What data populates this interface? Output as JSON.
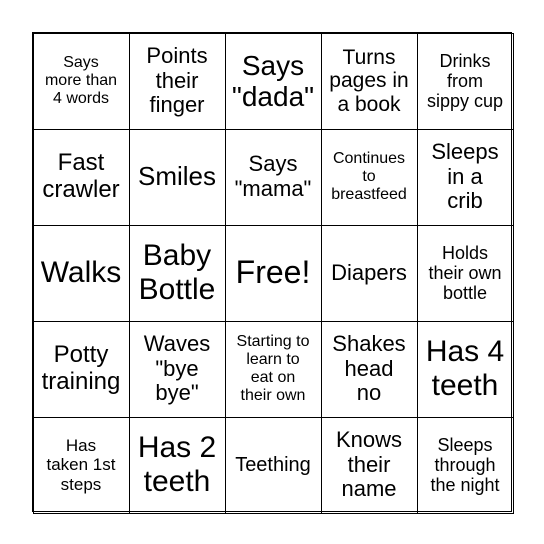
{
  "card": {
    "cells": [
      "Says\nmore than\n4 words",
      "Points\ntheir\nfinger",
      "Says\n\"dada\"",
      "Turns\npages in\na book",
      "Drinks\nfrom\nsippy cup",
      "Fast\ncrawler",
      "Smiles",
      "Says\n\"mama\"",
      "Continues\nto\nbreastfeed",
      "Sleeps\nin a\ncrib",
      "Walks",
      "Baby\nBottle",
      "Free!",
      "Diapers",
      "Holds\ntheir own\nbottle",
      "Potty\ntraining",
      "Waves\n\"bye\nbye\"",
      "Starting to\nlearn to\neat on\ntheir own",
      "Shakes\nhead\nno",
      "Has 4\nteeth",
      "Has\ntaken 1st\nsteps",
      "Has 2\nteeth",
      "Teething",
      "Knows\ntheir\nname",
      "Sleeps\nthrough\nthe night"
    ]
  }
}
